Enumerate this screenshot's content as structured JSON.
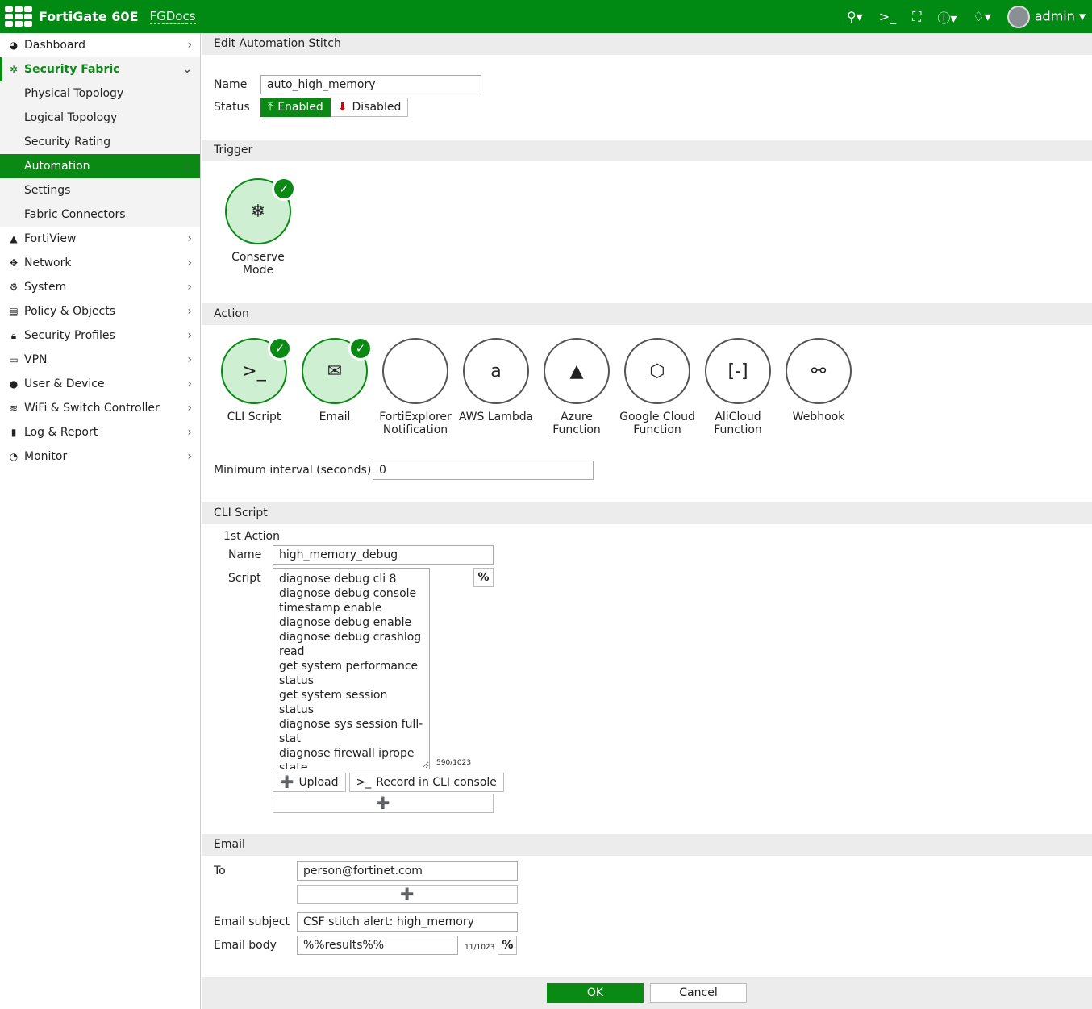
{
  "header": {
    "brand": "FortiGate 60E",
    "hostname": "FGDocs",
    "user": "admin"
  },
  "sidebar": {
    "items": [
      {
        "label": "Dashboard",
        "icon": "dashboard-icon"
      },
      {
        "label": "Security Fabric",
        "icon": "fabric-icon"
      },
      {
        "label": "Physical Topology"
      },
      {
        "label": "Logical Topology"
      },
      {
        "label": "Security Rating"
      },
      {
        "label": "Automation"
      },
      {
        "label": "Settings"
      },
      {
        "label": "Fabric Connectors"
      },
      {
        "label": "FortiView",
        "icon": "chart-icon"
      },
      {
        "label": "Network",
        "icon": "network-icon"
      },
      {
        "label": "System",
        "icon": "gear-icon"
      },
      {
        "label": "Policy & Objects",
        "icon": "policy-icon"
      },
      {
        "label": "Security Profiles",
        "icon": "lock-icon"
      },
      {
        "label": "VPN",
        "icon": "laptop-icon"
      },
      {
        "label": "User & Device",
        "icon": "user-icon"
      },
      {
        "label": "WiFi & Switch Controller",
        "icon": "wifi-icon"
      },
      {
        "label": "Log & Report",
        "icon": "bar-chart-icon"
      },
      {
        "label": "Monitor",
        "icon": "pie-icon"
      }
    ]
  },
  "page": {
    "title": "Edit Automation Stitch",
    "name_label": "Name",
    "name_value": "auto_high_memory",
    "status_label": "Status",
    "enabled": "Enabled",
    "disabled": "Disabled",
    "status_value": "Enabled"
  },
  "trigger": {
    "title": "Trigger",
    "tile_line1": "Conserve",
    "tile_line2": "Mode"
  },
  "action": {
    "title": "Action",
    "tiles": [
      {
        "l1": "CLI Script",
        "l2": "",
        "selected": true
      },
      {
        "l1": "Email",
        "l2": "",
        "selected": true
      },
      {
        "l1": "FortiExplorer",
        "l2": "Notification",
        "selected": false
      },
      {
        "l1": "AWS Lambda",
        "l2": "",
        "selected": false
      },
      {
        "l1": "Azure",
        "l2": "Function",
        "selected": false
      },
      {
        "l1": "Google Cloud",
        "l2": "Function",
        "selected": false
      },
      {
        "l1": "AliCloud",
        "l2": "Function",
        "selected": false
      },
      {
        "l1": "Webhook",
        "l2": "",
        "selected": false
      }
    ],
    "interval_label": "Minimum interval (seconds)",
    "interval_value": "0"
  },
  "cli": {
    "title": "CLI Script",
    "action_label": "1st Action",
    "name_label": "Name",
    "name_value": "high_memory_debug",
    "script_label": "Script",
    "script": "diagnose debug cli 8\ndiagnose debug console timestamp enable\ndiagnose debug enable\ndiagnose debug crashlog read\nget system performance status\nget system session status\ndiagnose sys session full-stat\ndiagnose firewall iprope state\ndiagnose sys flash list",
    "count": "590/1023",
    "upload": "Upload",
    "record": "Record in CLI console",
    "percent": "%"
  },
  "email": {
    "title": "Email",
    "to_label": "To",
    "to_value": "person@fortinet.com",
    "subject_label": "Email subject",
    "subject_value": "CSF stitch alert: high_memory",
    "body_label": "Email body",
    "body_value": "%%results%%",
    "count": "11/1023",
    "percent": "%"
  },
  "footer": {
    "ok": "OK",
    "cancel": "Cancel"
  }
}
